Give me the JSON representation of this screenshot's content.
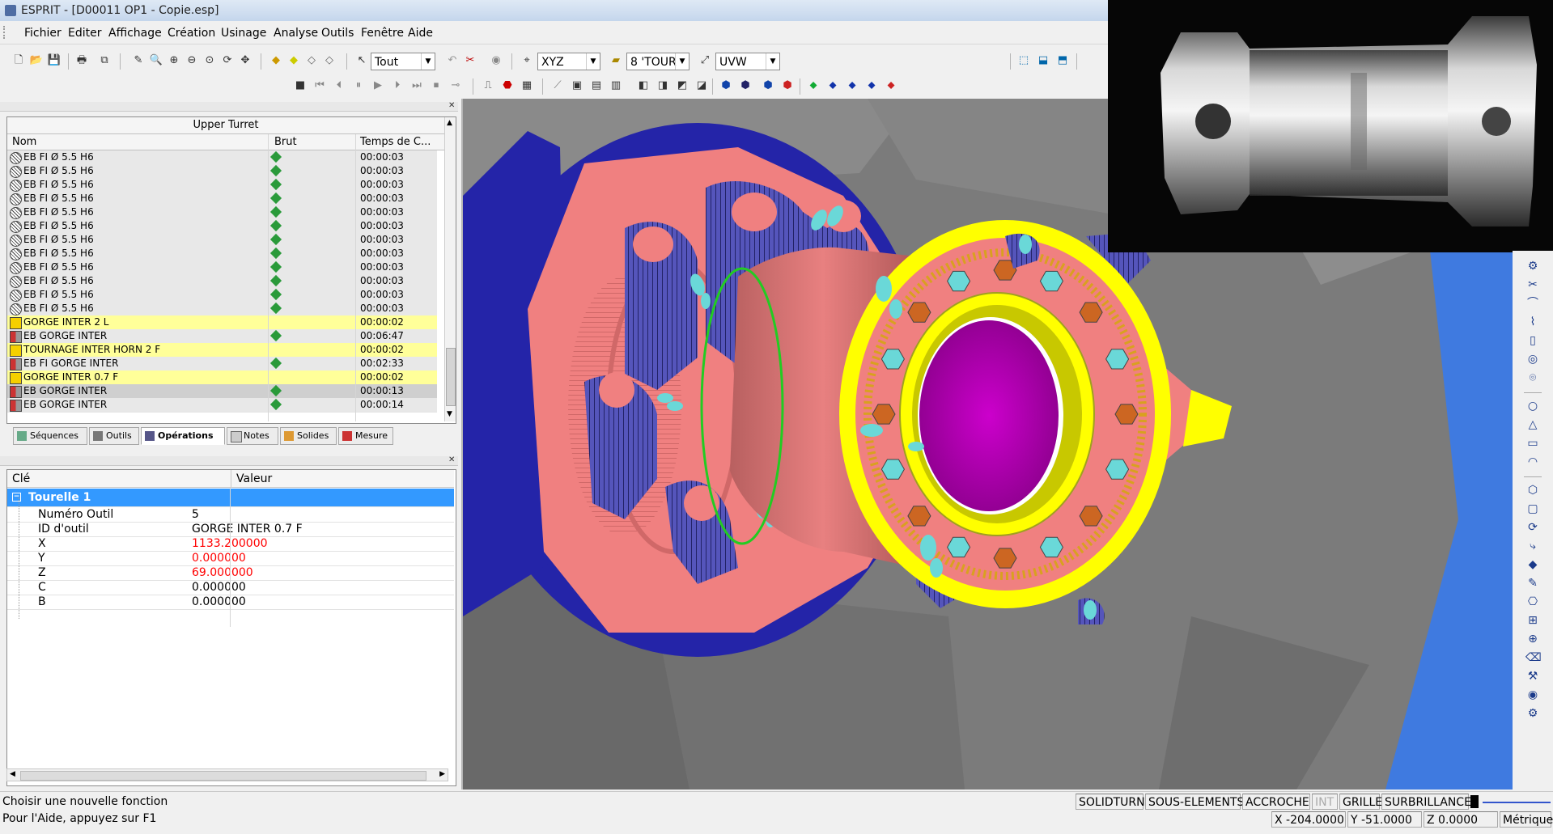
{
  "window": {
    "title": "ESPRIT - [D00011 OP1  - Copie.esp]"
  },
  "menu": [
    "Fichier",
    "Editer",
    "Affichage",
    "Création",
    "Usinage",
    "Analyse",
    "Outils",
    "Fenêtre",
    "Aide"
  ],
  "toolbar": {
    "selection_filter": "Tout",
    "coord_system": "XYZ",
    "workplane": "8 'TOUR",
    "uvw": "UVW"
  },
  "operations_panel": {
    "title": "Upper Turret",
    "columns": [
      "Nom",
      "Brut",
      "Temps de C..."
    ],
    "rows": [
      {
        "name": "EB FI Ø 5.5 H6",
        "time": "00:00:03",
        "type": "drill",
        "brut": true,
        "highlight": "none"
      },
      {
        "name": "EB FI Ø 5.5 H6",
        "time": "00:00:03",
        "type": "drill",
        "brut": true,
        "highlight": "none"
      },
      {
        "name": "EB FI Ø 5.5 H6",
        "time": "00:00:03",
        "type": "drill",
        "brut": true,
        "highlight": "none"
      },
      {
        "name": "EB FI Ø 5.5 H6",
        "time": "00:00:03",
        "type": "drill",
        "brut": true,
        "highlight": "none"
      },
      {
        "name": "EB FI Ø 5.5 H6",
        "time": "00:00:03",
        "type": "drill",
        "brut": true,
        "highlight": "none"
      },
      {
        "name": "EB FI Ø 5.5 H6",
        "time": "00:00:03",
        "type": "drill",
        "brut": true,
        "highlight": "none"
      },
      {
        "name": "EB FI Ø 5.5 H6",
        "time": "00:00:03",
        "type": "drill",
        "brut": true,
        "highlight": "none"
      },
      {
        "name": "EB FI Ø 5.5 H6",
        "time": "00:00:03",
        "type": "drill",
        "brut": true,
        "highlight": "none"
      },
      {
        "name": "EB FI Ø 5.5 H6",
        "time": "00:00:03",
        "type": "drill",
        "brut": true,
        "highlight": "none"
      },
      {
        "name": "EB FI Ø 5.5 H6",
        "time": "00:00:03",
        "type": "drill",
        "brut": true,
        "highlight": "none"
      },
      {
        "name": "EB FI Ø 5.5 H6",
        "time": "00:00:03",
        "type": "drill",
        "brut": true,
        "highlight": "none"
      },
      {
        "name": "EB FI Ø 5.5 H6",
        "time": "00:00:03",
        "type": "drill",
        "brut": true,
        "highlight": "none"
      },
      {
        "name": "GORGE INTER 2 L",
        "time": "00:00:02",
        "type": "tool",
        "brut": false,
        "highlight": "yellow"
      },
      {
        "name": "EB GORGE INTER",
        "time": "00:06:47",
        "type": "turn",
        "brut": true,
        "highlight": "none"
      },
      {
        "name": "TOURNAGE INTER HORN 2 F",
        "time": "00:00:02",
        "type": "tool",
        "brut": false,
        "highlight": "yellow"
      },
      {
        "name": "EB FI GORGE INTER",
        "time": "00:02:33",
        "type": "turn",
        "brut": true,
        "highlight": "none"
      },
      {
        "name": "GORGE INTER 0.7 F",
        "time": "00:00:02",
        "type": "tool",
        "brut": false,
        "highlight": "yellow"
      },
      {
        "name": "EB GORGE INTER",
        "time": "00:00:13",
        "type": "turn",
        "brut": true,
        "highlight": "selected"
      },
      {
        "name": "EB GORGE INTER",
        "time": "00:00:14",
        "type": "turn",
        "brut": true,
        "highlight": "none"
      }
    ],
    "tabs": [
      "Séquences",
      "Outils",
      "Opérations",
      "Notes",
      "Solides",
      "Mesure"
    ],
    "active_tab": "Opérations"
  },
  "properties": {
    "columns": [
      "Clé",
      "Valeur"
    ],
    "group": "Tourelle 1",
    "rows": [
      {
        "key": "Numéro Outil",
        "value": "5",
        "red": false
      },
      {
        "key": "ID d'outil",
        "value": "GORGE INTER 0.7 F",
        "red": false
      },
      {
        "key": "X",
        "value": "1133.200000",
        "red": true
      },
      {
        "key": "Y",
        "value": "0.000000",
        "red": true
      },
      {
        "key": "Z",
        "value": "69.000000",
        "red": true
      },
      {
        "key": "C",
        "value": "0.000000",
        "red": false
      },
      {
        "key": "B",
        "value": "0.000000",
        "red": false
      }
    ]
  },
  "status": {
    "message": "Choisir une nouvelle fonction",
    "help": "Pour l'Aide, appuyez sur F1",
    "modes": [
      "SOLIDTURN",
      "SOUS-ELEMENTS",
      "ACCROCHE",
      "INT",
      "GRILLE",
      "SURBRILLANCE"
    ],
    "x": "X -204.0000",
    "y": "Y -51.0000",
    "z": "Z 0.0000",
    "units": "Métrique"
  },
  "colors": {
    "part_salmon": "#f08080",
    "feature_blue": "#5555bb",
    "chuck_blue": "#2222aa",
    "fixture_yellow": "#ffff00",
    "bore_magenta": "#bb00bb",
    "hole_cyan": "#6ad8d8",
    "bolt_orange": "#cc6622",
    "selection_bar": "#3399ff",
    "highlight_yellow": "#ffff99",
    "value_red": "#ff0000"
  }
}
